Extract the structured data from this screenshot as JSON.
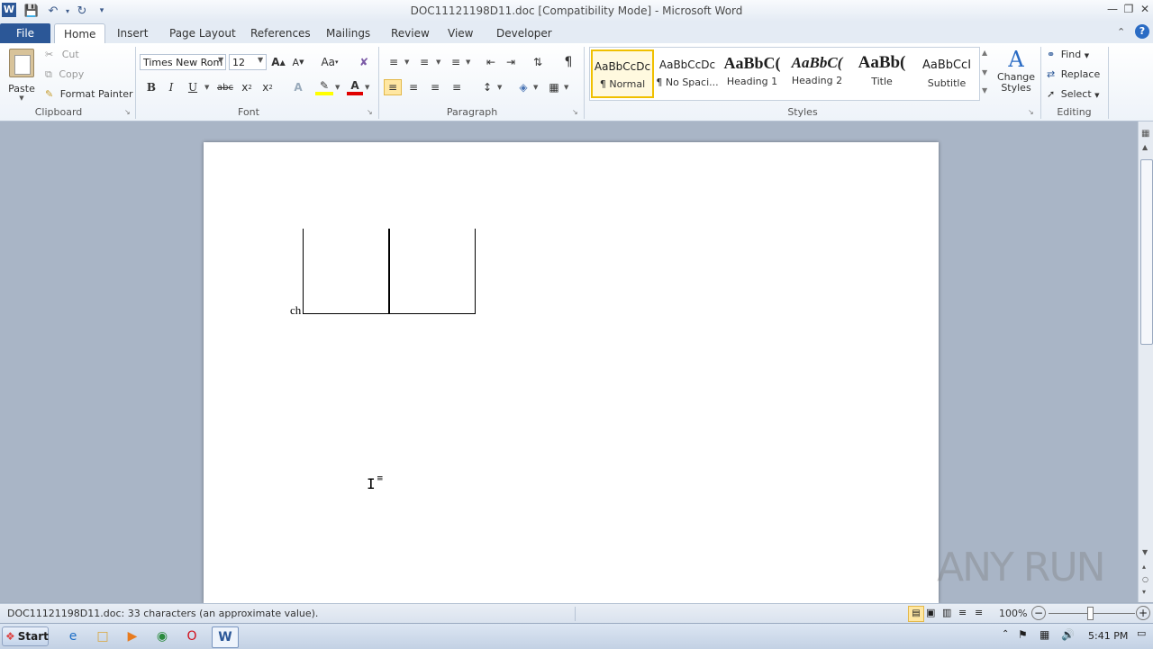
{
  "window": {
    "title": "DOC11121198D11.doc [Compatibility Mode]  -  Microsoft Word"
  },
  "tabs": [
    "File",
    "Home",
    "Insert",
    "Page Layout",
    "References",
    "Mailings",
    "Review",
    "View",
    "Developer"
  ],
  "clipboard": {
    "paste": "Paste",
    "cut": "Cut",
    "copy": "Copy",
    "format_painter": "Format Painter",
    "label": "Clipboard"
  },
  "font": {
    "name": "Times New Rom",
    "size": "12",
    "label": "Font"
  },
  "paragraph": {
    "label": "Paragraph"
  },
  "styles": {
    "items": [
      {
        "sample": "AaBbCcDc",
        "name": "¶ Normal"
      },
      {
        "sample": "AaBbCcDc",
        "name": "¶ No Spaci..."
      },
      {
        "sample": "AaBbC(",
        "name": "Heading 1"
      },
      {
        "sample": "AaBbC(",
        "name": "Heading 2"
      },
      {
        "sample": "AaBb(",
        "name": "Title"
      },
      {
        "sample": "AaBbCcI",
        "name": "Subtitle"
      }
    ],
    "change_styles": "Change Styles",
    "label": "Styles"
  },
  "editing": {
    "find": "Find",
    "replace": "Replace",
    "select": "Select",
    "label": "Editing"
  },
  "document": {
    "fragment_text": "ch"
  },
  "statusbar": {
    "text": "DOC11121198D11.doc: 33 characters (an approximate value).",
    "zoom": "100%"
  },
  "taskbar": {
    "start": "Start",
    "time": "5:41 PM"
  },
  "watermark": "ANY RUN"
}
